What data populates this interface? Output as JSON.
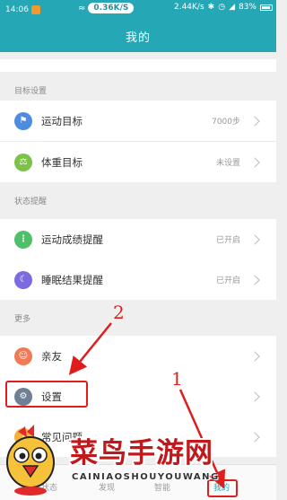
{
  "status_bar": {
    "time": "14:06",
    "net_speed": "0.36K/S",
    "net_speed_2": "2.44K/s",
    "battery": "83%"
  },
  "header": {
    "title": "我的"
  },
  "sections": [
    {
      "title": "目标设置",
      "items": [
        {
          "label": "运动目标",
          "value": "7000步",
          "icon": "flag-icon",
          "color": "#4f8be0"
        },
        {
          "label": "体重目标",
          "value": "未设置",
          "icon": "scale-icon",
          "color": "#7cc24a"
        }
      ]
    },
    {
      "title": "状态提醒",
      "items": [
        {
          "label": "运动成绩提醒",
          "value": "已开启",
          "icon": "footprint-icon",
          "color": "#4fbf6a"
        },
        {
          "label": "睡眠结果提醒",
          "value": "已开启",
          "icon": "moon-icon",
          "color": "#7a6be0"
        }
      ]
    },
    {
      "title": "更多",
      "items": [
        {
          "label": "亲友",
          "value": "",
          "icon": "friends-icon",
          "color": "#f07a55"
        },
        {
          "label": "设置",
          "value": "",
          "icon": "gear-icon",
          "color": "#6f7f95"
        },
        {
          "label": "常见问题",
          "value": "",
          "icon": "question-icon",
          "color": "#f2b23a"
        }
      ]
    }
  ],
  "annotations": {
    "step1": "1",
    "step2": "2"
  },
  "tabbar": {
    "tabs": [
      "状态",
      "发现",
      "智能",
      "我的"
    ]
  },
  "watermark": {
    "text_cn": "菜鸟手游网",
    "text_en": "CAINIAOSHOUYOUWANG"
  }
}
